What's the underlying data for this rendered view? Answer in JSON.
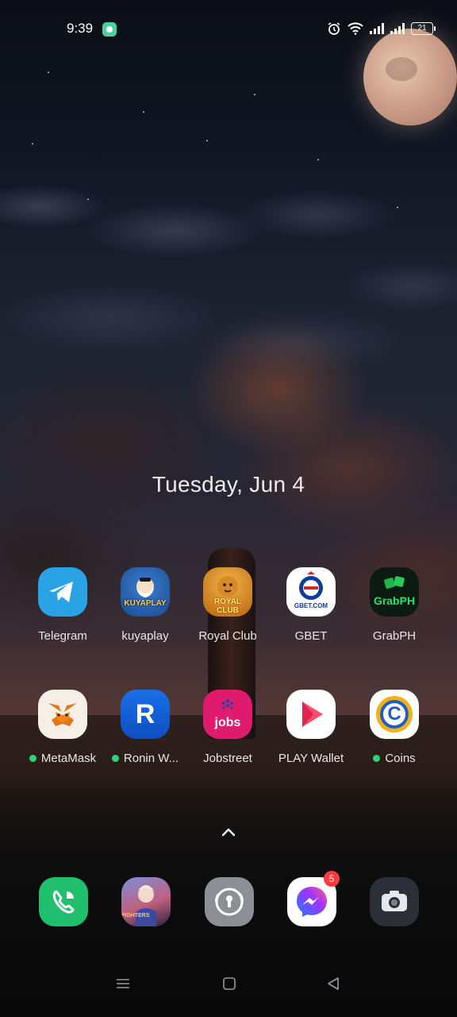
{
  "status_bar": {
    "time": "9:39",
    "battery_level": "21",
    "icons": [
      "alarm-icon",
      "wifi-icon",
      "signal-icon",
      "signal-icon",
      "battery-icon"
    ]
  },
  "date_text": "Tuesday, Jun 4",
  "apps_row1": [
    {
      "label": "Telegram",
      "icon": "telegram-icon"
    },
    {
      "label": "kuyaplay",
      "icon": "kuyaplay-icon"
    },
    {
      "label": "Royal Club",
      "icon": "royal-club-icon"
    },
    {
      "label": "GBET",
      "icon": "gbet-icon"
    },
    {
      "label": "GrabPH",
      "icon": "grabph-icon"
    }
  ],
  "apps_row2": [
    {
      "label": "MetaMask",
      "icon": "metamask-icon",
      "new_dot": true
    },
    {
      "label": "Ronin W...",
      "icon": "ronin-wallet-icon",
      "new_dot": true
    },
    {
      "label": "Jobstreet",
      "icon": "jobstreet-icon",
      "new_dot": false
    },
    {
      "label": "PLAY Wallet",
      "icon": "play-wallet-icon",
      "new_dot": false
    },
    {
      "label": "Coins",
      "icon": "coins-icon",
      "new_dot": true
    }
  ],
  "icon_text": {
    "kuyaplay": "KUYAPLAY",
    "royal_club": "ROYAL CLUB",
    "gbet": "GBET.COM",
    "grabph": "GrabPH",
    "jobstreet": "jobs",
    "ronin": "R",
    "coins": "C"
  },
  "dock": [
    {
      "name": "phone",
      "icon": "phone-icon"
    },
    {
      "name": "game",
      "icon": "game-icon",
      "icon_text": "FIGHTERS"
    },
    {
      "name": "vpn",
      "icon": "vpn-lock-icon"
    },
    {
      "name": "messenger",
      "icon": "messenger-icon",
      "badge": "5"
    },
    {
      "name": "camera",
      "icon": "camera-icon"
    }
  ],
  "colors": {
    "telegram": "#2aa3e6",
    "jobstreet": "#e01a6c",
    "phone": "#1fbf6e",
    "dock_gray": "#8d8f96",
    "camera": "#2b2f38",
    "new_dot": "#33d07a",
    "badge": "#ff3b3b"
  }
}
